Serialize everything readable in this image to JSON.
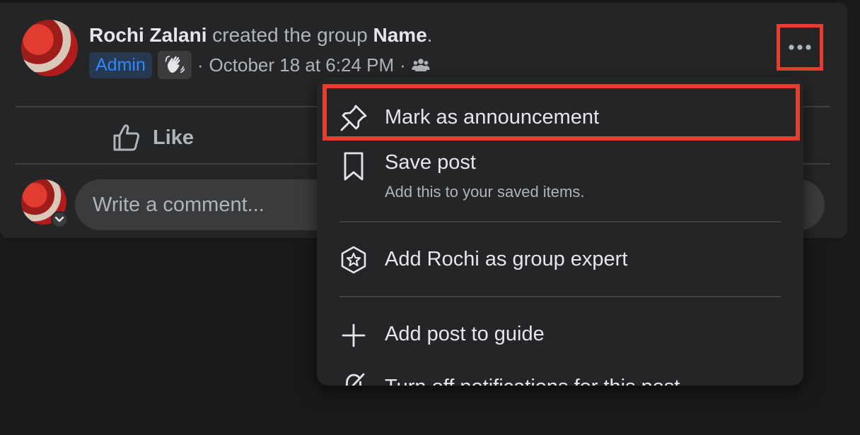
{
  "post": {
    "author": "Rochi Zalani",
    "action_text": " created the group ",
    "group_name": "Name",
    "period": ".",
    "badge": "Admin",
    "separator_1": "·",
    "timestamp": "October 18 at 6:24 PM",
    "separator_2": "·",
    "privacy_icon": "group-privacy-icon",
    "wave_icon": "waving-hand-icon",
    "more_icon": "more-options-icon"
  },
  "actions": {
    "like_label": "Like"
  },
  "comment": {
    "placeholder": "Write a comment..."
  },
  "menu": {
    "items": [
      {
        "icon": "pin-icon",
        "label": "Mark as announcement"
      },
      {
        "icon": "bookmark-icon",
        "label": "Save post",
        "sublabel": "Add this to your saved items."
      },
      {
        "icon": "star-badge-icon",
        "label": "Add Rochi as group expert"
      },
      {
        "icon": "plus-icon",
        "label": "Add post to guide"
      },
      {
        "icon": "bell-off-icon",
        "label": "Turn off notifications for this post"
      }
    ]
  },
  "colors": {
    "background": "#18191a",
    "card": "#242526",
    "highlight": "#e53e31",
    "badge_text": "#2d88ff"
  }
}
